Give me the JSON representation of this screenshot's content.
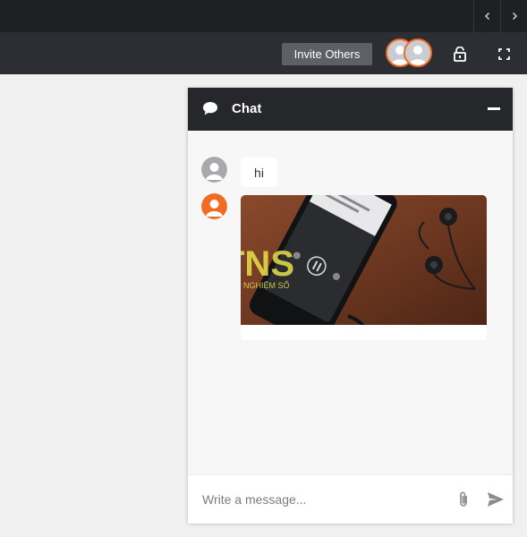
{
  "toolbar": {
    "invite_label": "Invite Others"
  },
  "chat": {
    "title": "Chat",
    "messages": [
      {
        "type": "text",
        "text": "hi",
        "avatar_color": "#a7a9ad"
      },
      {
        "type": "image",
        "avatar_color": "#f26b22",
        "watermark_logo": "TNS",
        "watermark_text": "TRẢI NGHIỆM SỐ"
      }
    ],
    "input_placeholder": "Write a message..."
  },
  "colors": {
    "accent": "#f26b22",
    "header_bg": "#26272b",
    "toolbar_bg": "#2c2e33"
  }
}
